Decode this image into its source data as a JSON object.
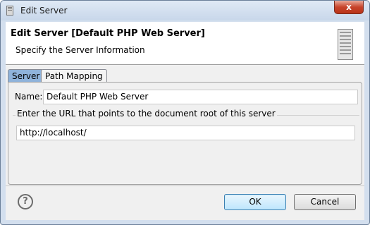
{
  "window": {
    "title": "Edit Server",
    "close_label": "x"
  },
  "header": {
    "title": "Edit Server [Default PHP Web Server]",
    "subtitle": "Specify the Server Information",
    "icon": "server-tower-icon"
  },
  "tabs": [
    {
      "label": "Server",
      "selected": true
    },
    {
      "label": "Path Mapping",
      "selected": false
    }
  ],
  "form": {
    "name_label": "Name:",
    "name_value": "Default PHP Web Server",
    "url_group_label": "Enter the URL that points to the document root of this server",
    "url_value": "http://localhost/"
  },
  "footer": {
    "help_icon": "help-question-icon",
    "help_glyph": "?",
    "ok_label": "OK",
    "cancel_label": "Cancel"
  },
  "colors": {
    "frame": "#d3dfee",
    "selected_tab": "#8fb3db",
    "close_button": "#c7442c",
    "default_button_border": "#3c7fb1"
  }
}
